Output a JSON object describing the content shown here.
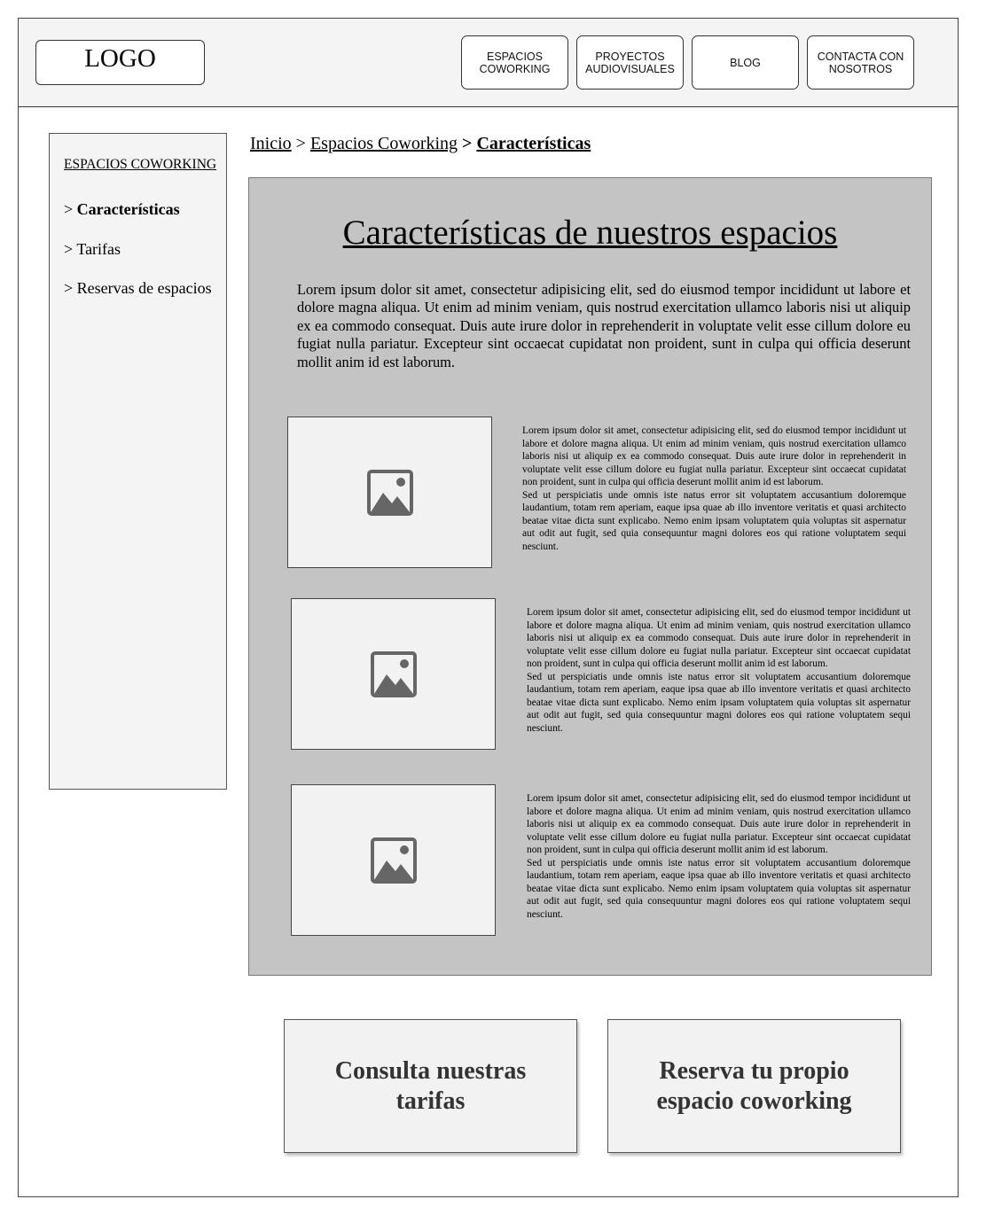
{
  "header": {
    "logo": "LOGO",
    "nav": [
      {
        "label": "ESPACIOS\nCOWORKING"
      },
      {
        "label": "PROYECTOS\nAUDIOVISUALES"
      },
      {
        "label": "BLOG"
      },
      {
        "label": "CONTACTA CON\nNOSOTROS"
      }
    ]
  },
  "sidebar": {
    "title": "ESPACIOS COWORKING",
    "items": [
      {
        "prefix": "> ",
        "label": "Características",
        "active": true
      },
      {
        "prefix": "> ",
        "label": "Tarifas",
        "active": false
      },
      {
        "prefix": "> ",
        "label": "Reservas de espacios",
        "active": false
      }
    ]
  },
  "breadcrumb": {
    "items": [
      "Inicio",
      "Espacios Coworking"
    ],
    "separator": ">",
    "current": "Características"
  },
  "main": {
    "title": "Características de nuestros espacios",
    "intro": "Lorem ipsum dolor sit amet, consectetur adipisicing elit, sed do eiusmod tempor incididunt ut labore et dolore magna aliqua. Ut enim ad minim veniam, quis nostrud exercitation ullamco laboris nisi ut aliquip ex ea commodo consequat. Duis aute irure dolor in reprehenderit in voluptate velit esse cillum dolore eu fugiat nulla pariatur. Excepteur sint occaecat cupidatat non proident, sunt in culpa qui officia deserunt mollit anim id est laborum.",
    "features": [
      {
        "icon": "image-placeholder-icon",
        "p1": "Lorem ipsum dolor sit amet, consectetur adipisicing elit, sed do eiusmod tempor incididunt ut labore et dolore magna aliqua. Ut enim ad minim veniam, quis nostrud exercitation ullamco laboris nisi ut aliquip ex ea commodo consequat. Duis aute irure dolor in reprehenderit in voluptate velit esse cillum dolore eu fugiat nulla pariatur. Excepteur sint occaecat cupidatat non proident, sunt in culpa qui officia deserunt mollit anim id est laborum.",
        "p2": "Sed ut perspiciatis unde omnis iste natus error sit voluptatem accusantium doloremque laudantium, totam rem aperiam, eaque ipsa quae ab illo inventore veritatis et quasi architecto beatae vitae dicta sunt explicabo. Nemo enim ipsam voluptatem quia voluptas sit aspernatur aut odit aut fugit, sed quia consequuntur magni dolores eos qui ratione voluptatem sequi nesciunt."
      },
      {
        "icon": "image-placeholder-icon",
        "p1": "Lorem ipsum dolor sit amet, consectetur adipisicing elit, sed do eiusmod tempor incididunt ut labore et dolore magna aliqua. Ut enim ad minim veniam, quis nostrud exercitation ullamco laboris nisi ut aliquip ex ea commodo consequat. Duis aute irure dolor in reprehenderit in voluptate velit esse cillum dolore eu fugiat nulla pariatur. Excepteur sint occaecat cupidatat non proident, sunt in culpa qui officia deserunt mollit anim id est laborum.",
        "p2": "Sed ut perspiciatis unde omnis iste natus error sit voluptatem accusantium doloremque laudantium, totam rem aperiam, eaque ipsa quae ab illo inventore veritatis et quasi architecto beatae vitae dicta sunt explicabo. Nemo enim ipsam voluptatem quia voluptas sit aspernatur aut odit aut fugit, sed quia consequuntur magni dolores eos qui ratione voluptatem sequi nesciunt."
      },
      {
        "icon": "image-placeholder-icon",
        "p1": "Lorem ipsum dolor sit amet, consectetur adipisicing elit, sed do eiusmod tempor incididunt ut labore et dolore magna aliqua. Ut enim ad minim veniam, quis nostrud exercitation ullamco laboris nisi ut aliquip ex ea commodo consequat. Duis aute irure dolor in reprehenderit in voluptate velit esse cillum dolore eu fugiat nulla pariatur. Excepteur sint occaecat cupidatat non proident, sunt in culpa qui officia deserunt mollit anim id est laborum.",
        "p2": "Sed ut perspiciatis unde omnis iste natus error sit voluptatem accusantium doloremque laudantium, totam rem aperiam, eaque ipsa quae ab illo inventore veritatis et quasi architecto beatae vitae dicta sunt explicabo. Nemo enim ipsam voluptatem quia voluptas sit aspernatur aut odit aut fugit, sed quia consequuntur magni dolores eos qui ratione voluptatem sequi nesciunt."
      }
    ]
  },
  "cta": {
    "tarifas": "Consulta nuestras tarifas",
    "reserva": "Reserva tu propio espacio coworking"
  },
  "colors": {
    "header_bg": "#f4f4f4",
    "content_bg": "#c4c4c4",
    "placeholder_icon": "#666666"
  }
}
